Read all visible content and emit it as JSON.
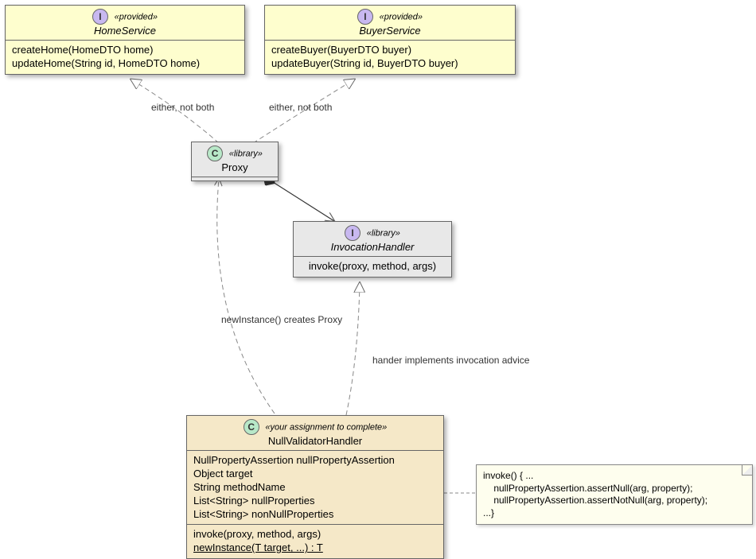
{
  "homeService": {
    "stereo": "«provided»",
    "name": "HomeService",
    "methods": [
      "createHome(HomeDTO home)",
      "updateHome(String id, HomeDTO home)"
    ]
  },
  "buyerService": {
    "stereo": "«provided»",
    "name": "BuyerService",
    "methods": [
      "createBuyer(BuyerDTO buyer)",
      "updateBuyer(String id, BuyerDTO buyer)"
    ]
  },
  "proxy": {
    "stereo": "«library»",
    "name": "Proxy"
  },
  "invocationHandler": {
    "stereo": "«library»",
    "name": "InvocationHandler",
    "methods": [
      "invoke(proxy, method, args)"
    ]
  },
  "nullValidator": {
    "stereo": "«your assignment to complete»",
    "name": "NullValidatorHandler",
    "attrs": [
      "NullPropertyAssertion nullPropertyAssertion",
      "Object target",
      "String methodName",
      "List<String> nullProperties",
      "List<String> nonNullProperties"
    ],
    "methods": [
      "invoke(proxy, method, args)",
      "newInstance(T target, ...) : T"
    ]
  },
  "note": {
    "line1": "invoke() { ...",
    "line2": "    nullPropertyAssertion.assertNull(arg, property);",
    "line3": "    nullPropertyAssertion.assertNotNull(arg, property);",
    "line4": "...}"
  },
  "labels": {
    "eitherLeft": "either, not both",
    "eitherRight": "either, not both",
    "newInstance": "newInstance() creates Proxy",
    "handlerImpl": "hander implements invocation advice"
  },
  "icons": {
    "interface": "I",
    "class": "C"
  }
}
